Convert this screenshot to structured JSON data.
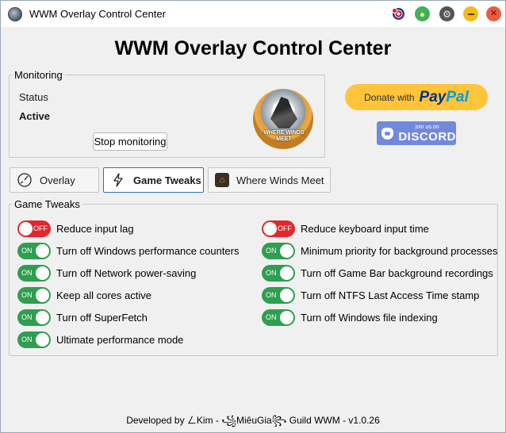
{
  "window": {
    "title": "WWM Overlay Control Center"
  },
  "titlebar_icons": [
    "language-flag-icon",
    "lightbulb-icon",
    "settings-icon",
    "minimize-icon",
    "close-icon"
  ],
  "header": {
    "title": "WWM Overlay Control Center"
  },
  "monitoring": {
    "group_label": "Monitoring",
    "status_label": "Status",
    "status_value": "Active",
    "stop_button": "Stop monitoring",
    "logo_text": "WHERE WINDS MEET"
  },
  "donate": {
    "with_label": "Donate with",
    "brand_pay": "Pay",
    "brand_pal": "Pal",
    "discord_small": "join us on",
    "discord_big": "DISCORD"
  },
  "tabs": [
    {
      "label": "Overlay",
      "active": false,
      "icon": "gauge-icon"
    },
    {
      "label": "Game Tweaks",
      "active": true,
      "icon": "lightning-icon"
    },
    {
      "label": "Where Winds Meet",
      "active": false,
      "icon": "game-icon"
    }
  ],
  "tweaks": {
    "group_label": "Game Tweaks",
    "on_text": "ON",
    "off_text": "OFF",
    "left": [
      {
        "label": "Reduce input lag",
        "on": false
      },
      {
        "label": "Turn off Windows performance counters",
        "on": true
      },
      {
        "label": "Turn off Network power-saving",
        "on": true
      },
      {
        "label": "Keep all cores active",
        "on": true
      },
      {
        "label": "Turn off SuperFetch",
        "on": true
      },
      {
        "label": "Ultimate performance mode",
        "on": true
      }
    ],
    "right": [
      {
        "label": "Reduce keyboard input time",
        "on": false
      },
      {
        "label": "Minimum priority for background processes",
        "on": true
      },
      {
        "label": "Turn off Game Bar background recordings",
        "on": true
      },
      {
        "label": "Turn off NTFS Last Access Time stamp",
        "on": true
      },
      {
        "label": "Turn off Windows file indexing",
        "on": true
      }
    ]
  },
  "footer": {
    "text": "Developed by ㄥKim - ꧁MiêuGia꧂ Guild WWM - v1.0.26"
  },
  "colors": {
    "toggle_on": "#2f9e50",
    "toggle_off": "#e2262b",
    "paypal_yellow": "#ffc439",
    "discord_blurple": "#7289da",
    "active_tab_border": "#2d6fb8"
  }
}
